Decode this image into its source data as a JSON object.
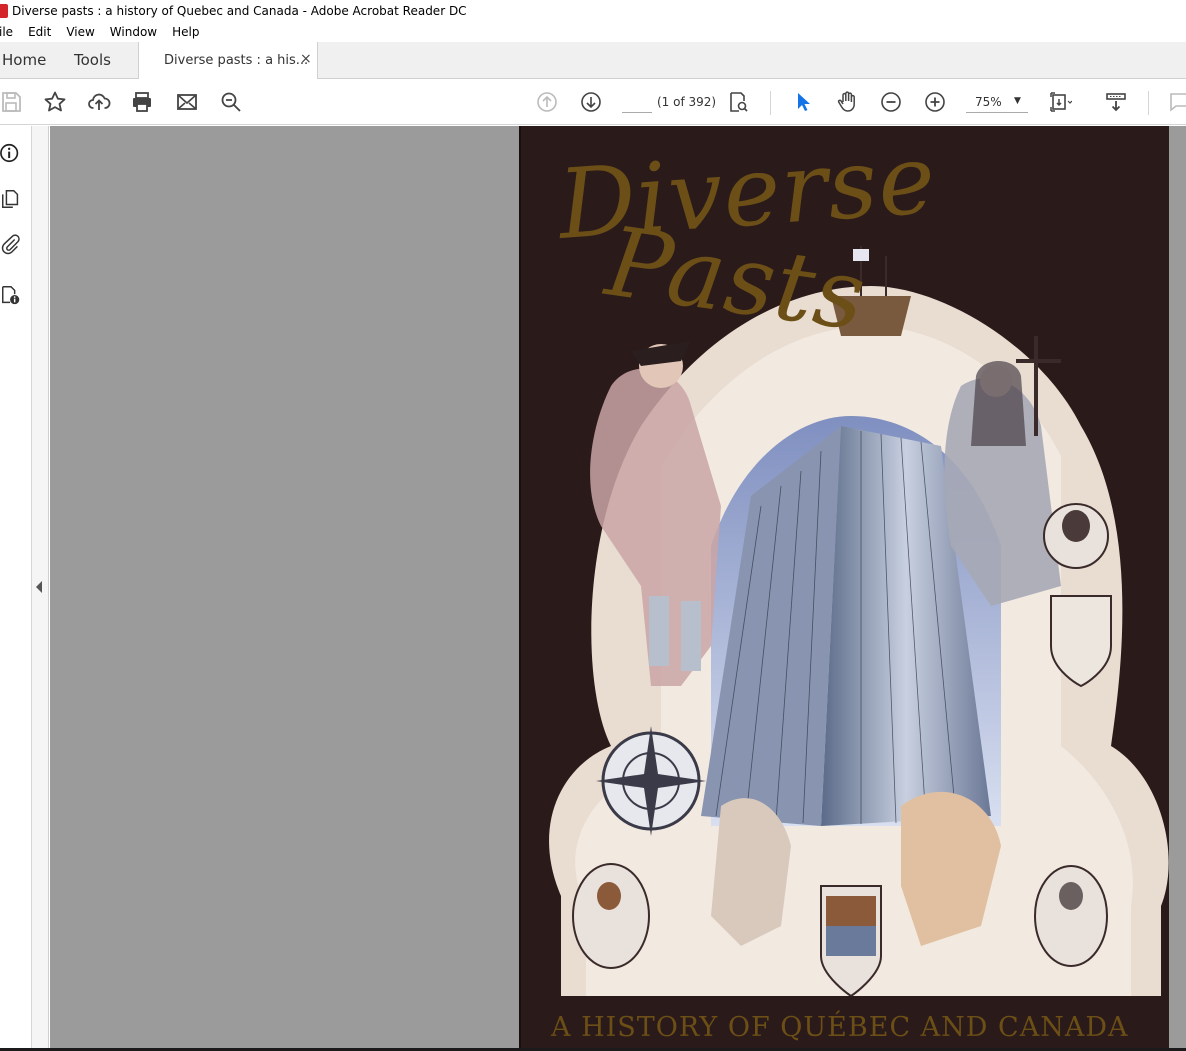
{
  "window": {
    "title": "Diverse pasts : a history of Quebec and Canada - Adobe Acrobat Reader DC"
  },
  "menu": {
    "items": [
      "ile",
      "Edit",
      "View",
      "Window",
      "Help"
    ]
  },
  "tabs": {
    "home": "Home",
    "tools": "Tools",
    "document": "Diverse pasts : a his...",
    "close": "×"
  },
  "toolbar": {
    "page_value": "",
    "page_count": "(1 of 392)",
    "zoom": "75%"
  },
  "cover": {
    "title_word1": "Diverse",
    "title_word2": "Pasts",
    "subtitle": "A HISTORY OF QUÉBEC AND CANADA"
  },
  "colors": {
    "accent_blue": "#1473e6",
    "cover_bg": "#2b1a1a",
    "cover_gold": "#6b4f16",
    "doc_bg": "#9b9b9b"
  }
}
